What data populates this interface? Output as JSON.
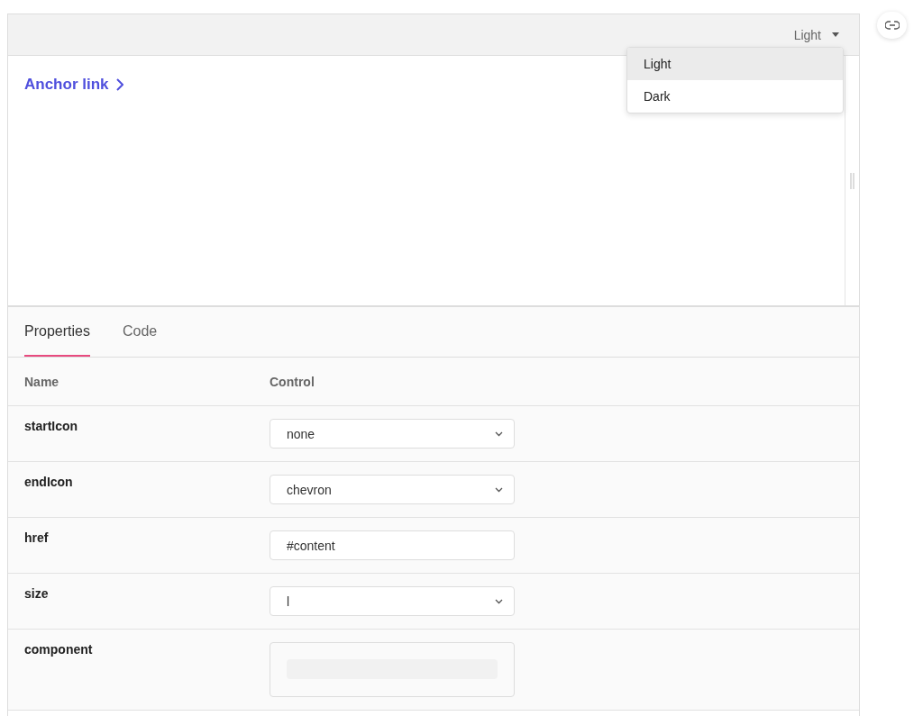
{
  "toolbar": {
    "theme_button": "Light"
  },
  "theme_menu": {
    "items": [
      {
        "label": "Light",
        "selected": true
      },
      {
        "label": "Dark",
        "selected": false
      }
    ]
  },
  "preview": {
    "link": "Anchor link"
  },
  "tabs": [
    {
      "label": "Properties",
      "selected": true
    },
    {
      "label": "Code",
      "selected": false
    }
  ],
  "table": {
    "columns": [
      "Name",
      "Control"
    ],
    "rows": [
      {
        "name": "startIcon",
        "kind": "select",
        "value": "none"
      },
      {
        "name": "endIcon",
        "kind": "select",
        "value": "chevron"
      },
      {
        "name": "href",
        "kind": "text",
        "value": "#content"
      },
      {
        "name": "size",
        "kind": "select",
        "value": "l"
      },
      {
        "name": "component",
        "kind": "object"
      }
    ]
  }
}
